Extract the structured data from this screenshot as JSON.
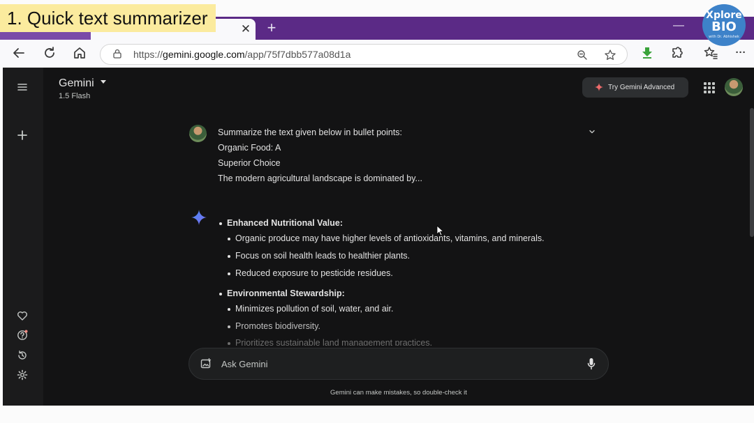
{
  "overlay": {
    "label": "1. Quick text summarizer",
    "logo_line1": "Xplore",
    "logo_line2": "BIO",
    "logo_line3": "with Dr. Abhishek"
  },
  "browser": {
    "tab_close": "✕",
    "new_tab": "+",
    "minimize": "—",
    "url_prefix": "https://",
    "url_host": "gemini.google.com",
    "url_path": "/app/75f7dbb577a08d1a",
    "menu": "···"
  },
  "header": {
    "title": "Gemini",
    "model": "1.5 Flash",
    "try_advanced_label": "Try Gemini Advanced"
  },
  "conversation": {
    "prompt_lines": [
      "Summarize the text given below in bullet points:",
      "Organic Food: A",
      "Superior Choice",
      "The modern agricultural landscape is dominated by..."
    ],
    "response": {
      "sections": [
        {
          "heading": "Enhanced Nutritional Value:",
          "items": [
            "Organic produce may have higher levels of antioxidants, vitamins, and minerals.",
            "Focus on soil health leads to healthier plants.",
            "Reduced exposure to pesticide residues."
          ]
        },
        {
          "heading": "Environmental Stewardship:",
          "items": [
            "Minimizes pollution of soil, water, and air.",
            "Promotes biodiversity.",
            "Prioritizes sustainable land management practices."
          ]
        }
      ]
    }
  },
  "input": {
    "placeholder": "Ask Gemini"
  },
  "footer": {
    "disclaimer": "Gemini can make mistakes, so double-check it"
  },
  "colors": {
    "tab_strip": "#5b2a86",
    "app_background": "#131314",
    "sidebar_background": "#1b1b1c",
    "text_primary": "#e3e3e3",
    "label_background": "#fbeb9e",
    "logo_background": "#3d82c9",
    "gemini_star_blue": "#4a8af4"
  }
}
